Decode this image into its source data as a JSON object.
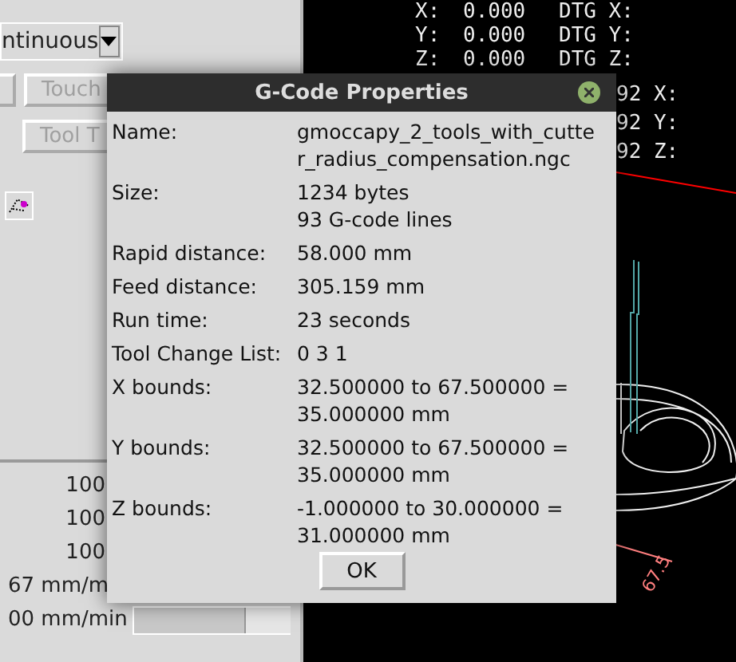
{
  "left_panel": {
    "mode_dropdown": {
      "value": "ntinuous"
    },
    "buttons": [
      {
        "label": "Touch"
      },
      {
        "label": "Tool T"
      }
    ],
    "overrides": [
      "100",
      "100",
      "100"
    ],
    "feeds": [
      {
        "reading": "67 mm/m"
      },
      {
        "reading": "00 mm/min",
        "level": 1
      }
    ]
  },
  "dro": {
    "rows": [
      {
        "axis": "X:",
        "value": "0.000",
        "dtg": "DTG X:"
      },
      {
        "axis": "Y:",
        "value": "0.000",
        "dtg": "DTG Y:"
      },
      {
        "axis": "Z:",
        "value": "0.000",
        "dtg": "DTG Z:"
      }
    ],
    "partial_rows": [
      "92 X:",
      "92 Y:",
      "92 Z:"
    ]
  },
  "plot": {
    "dimension_label": "67.5"
  },
  "dialog": {
    "title": "G-Code Properties",
    "fields": [
      {
        "label": "Name:",
        "lines": [
          "gmoccapy_2_tools_with_cutte",
          "r_radius_compensation.ngc"
        ]
      },
      {
        "label": "Size:",
        "lines": [
          "1234 bytes",
          "93 G-code lines"
        ]
      },
      {
        "label": "Rapid distance:",
        "lines": [
          "58.000 mm"
        ]
      },
      {
        "label": "Feed distance:",
        "lines": [
          "305.159 mm"
        ]
      },
      {
        "label": "Run time:",
        "lines": [
          "23 seconds"
        ]
      },
      {
        "label": "Tool Change List:",
        "lines": [
          "0 3 1"
        ]
      },
      {
        "label": "X bounds:",
        "lines": [
          "32.500000 to 67.500000 =",
          "35.000000 mm"
        ]
      },
      {
        "label": "Y bounds:",
        "lines": [
          "32.500000 to 67.500000 =",
          "35.000000 mm"
        ]
      },
      {
        "label": "Z bounds:",
        "lines": [
          "-1.000000 to 30.000000 =",
          "31.000000 mm"
        ]
      }
    ],
    "button": "OK"
  }
}
